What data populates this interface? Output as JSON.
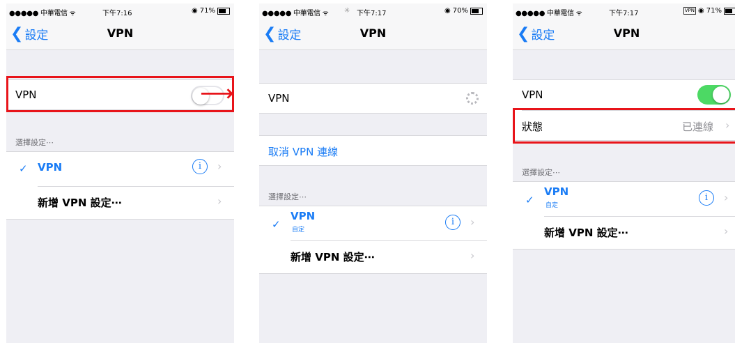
{
  "status_bar": {
    "carrier": "●●●●● 中華電信 ᯤ",
    "screen1": {
      "time": "下午7:16",
      "battery": "71%"
    },
    "screen2": {
      "time": "下午7:17",
      "battery": "70%"
    },
    "screen3": {
      "time": "下午7:17",
      "battery": "71%",
      "vpn_badge": "VPN"
    }
  },
  "nav": {
    "back_label": "設定",
    "back_chevron": "❮",
    "title": "VPN"
  },
  "vpn_row": {
    "label": "VPN"
  },
  "section_header": "選擇設定⋯",
  "config": {
    "name": "VPN",
    "sub": "自定",
    "check": "✓",
    "info": "i",
    "chevron": "›"
  },
  "add_config": {
    "label": "新增 VPN 設定⋯"
  },
  "cancel_connection": "取消 VPN 連線",
  "status_row": {
    "label": "狀態",
    "value": "已連線"
  },
  "annotation_arrow": "⟶",
  "icons": {
    "arrow": "red-arrow-icon",
    "spinner": "loading-spinner-icon"
  },
  "colors": {
    "accent": "#1a7cf5",
    "toggle_on": "#4cd964",
    "highlight": "#e8141a"
  }
}
